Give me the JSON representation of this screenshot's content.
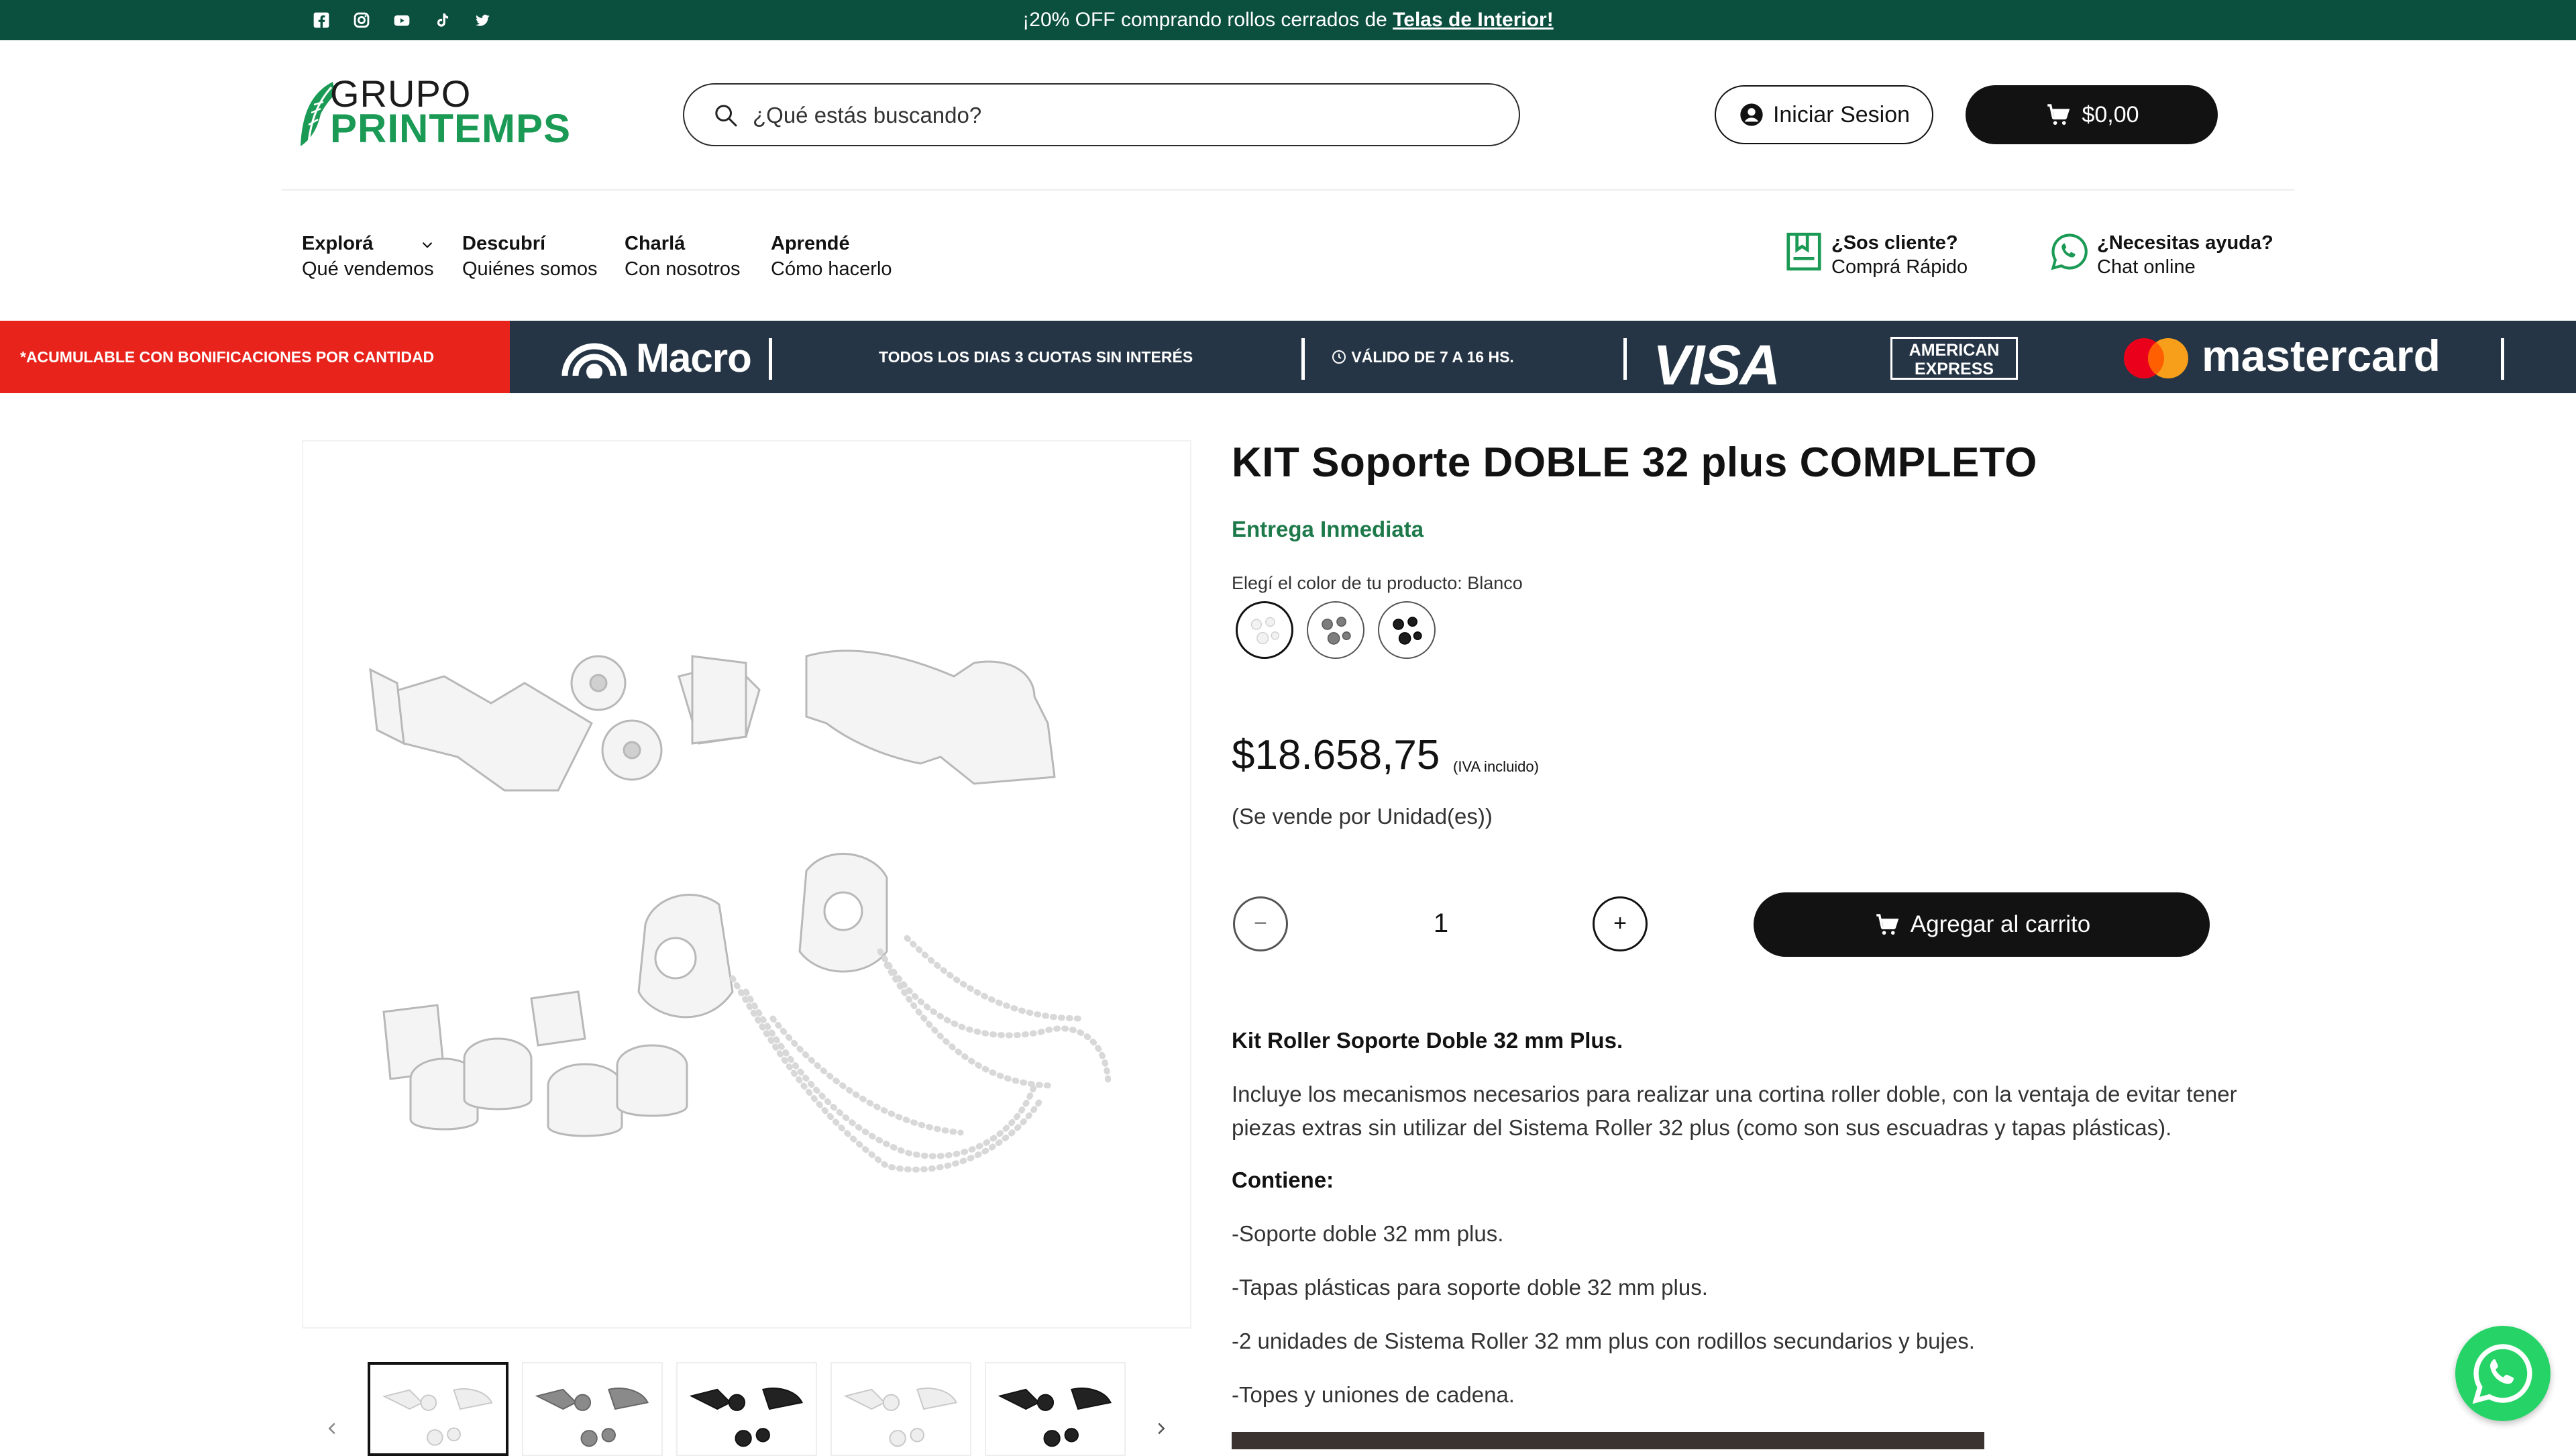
{
  "topbar": {
    "social_icons": [
      "facebook-icon",
      "instagram-icon",
      "youtube-icon",
      "tiktok-icon",
      "twitter-icon"
    ],
    "announcement_text": "¡20% OFF comprando rollos cerrados de ",
    "announcement_link": "Telas de Interior!",
    "bg_color": "#0b4f3f"
  },
  "header": {
    "logo_line1": "GRUPO",
    "logo_line2": "PRINTEMPS",
    "search_placeholder": "¿Qué estás buscando?",
    "login_label": "Iniciar Sesion",
    "cart_total": "$0,00"
  },
  "nav": {
    "items": [
      {
        "title": "Explorá",
        "subtitle": "Qué vendemos"
      },
      {
        "title": "Descubrí",
        "subtitle": "Quiénes somos"
      },
      {
        "title": "Charlá",
        "subtitle": "Con nosotros"
      },
      {
        "title": "Aprendé",
        "subtitle": "Cómo hacerlo"
      }
    ],
    "utilities": [
      {
        "title": "¿Sos cliente?",
        "subtitle": "Comprá Rápido",
        "icon": "bookmark-icon"
      },
      {
        "title": "¿Necesitas ayuda?",
        "subtitle": "Chat online",
        "icon": "whatsapp-icon"
      }
    ]
  },
  "promo": {
    "red_text": "*ACUMULABLE CON BONIFICACIONES POR CANTIDAD",
    "bank": "Macro",
    "installments": "TODOS LOS DIAS 3 CUOTAS SIN INTERÉS",
    "valid_hours": "VÁLIDO DE 7 A 16 HS.",
    "card_visa": "VISA",
    "card_amex_line1": "AMERICAN",
    "card_amex_line2": "EXPRESS",
    "card_mastercard": "mastercard",
    "colors": {
      "red": "#e8231c",
      "navy": "#253545"
    }
  },
  "product": {
    "title": "KIT Soporte DOBLE 32 plus COMPLETO",
    "delivery": "Entrega Inmediata",
    "color_label": "Elegí el color de tu producto: Blanco",
    "color_options": [
      "Blanco",
      "Gris",
      "Negro"
    ],
    "selected_color": "Blanco",
    "price": "$18.658,75",
    "tax_note": "(IVA incluido)",
    "unit_note": "(Se vende por Unidad(es))",
    "quantity": "1",
    "qty_minus": "−",
    "qty_plus": "+",
    "add_to_cart": "Agregar al carrito",
    "thumbnail_count": 5
  },
  "description": {
    "heading": "Kit Roller Soporte Doble 32 mm Plus.",
    "paragraph": "Incluye los mecanismos necesarios para realizar una cortina roller doble, con la ventaja de evitar tener piezas extras sin utilizar del Sistema Roller 32 plus (como son sus escuadras y tapas plásticas).",
    "contents_heading": "Contiene:",
    "items": [
      "-Soporte doble 32 mm plus.",
      "-Tapas plásticas para soporte doble 32 mm plus.",
      "-2 unidades de Sistema Roller 32 mm plus con rodillos secundarios y bujes.",
      "-Topes y uniones de cadena."
    ]
  },
  "brand_colors": {
    "green": "#1a9a54",
    "dark": "#121212",
    "whatsapp": "#25d366"
  }
}
